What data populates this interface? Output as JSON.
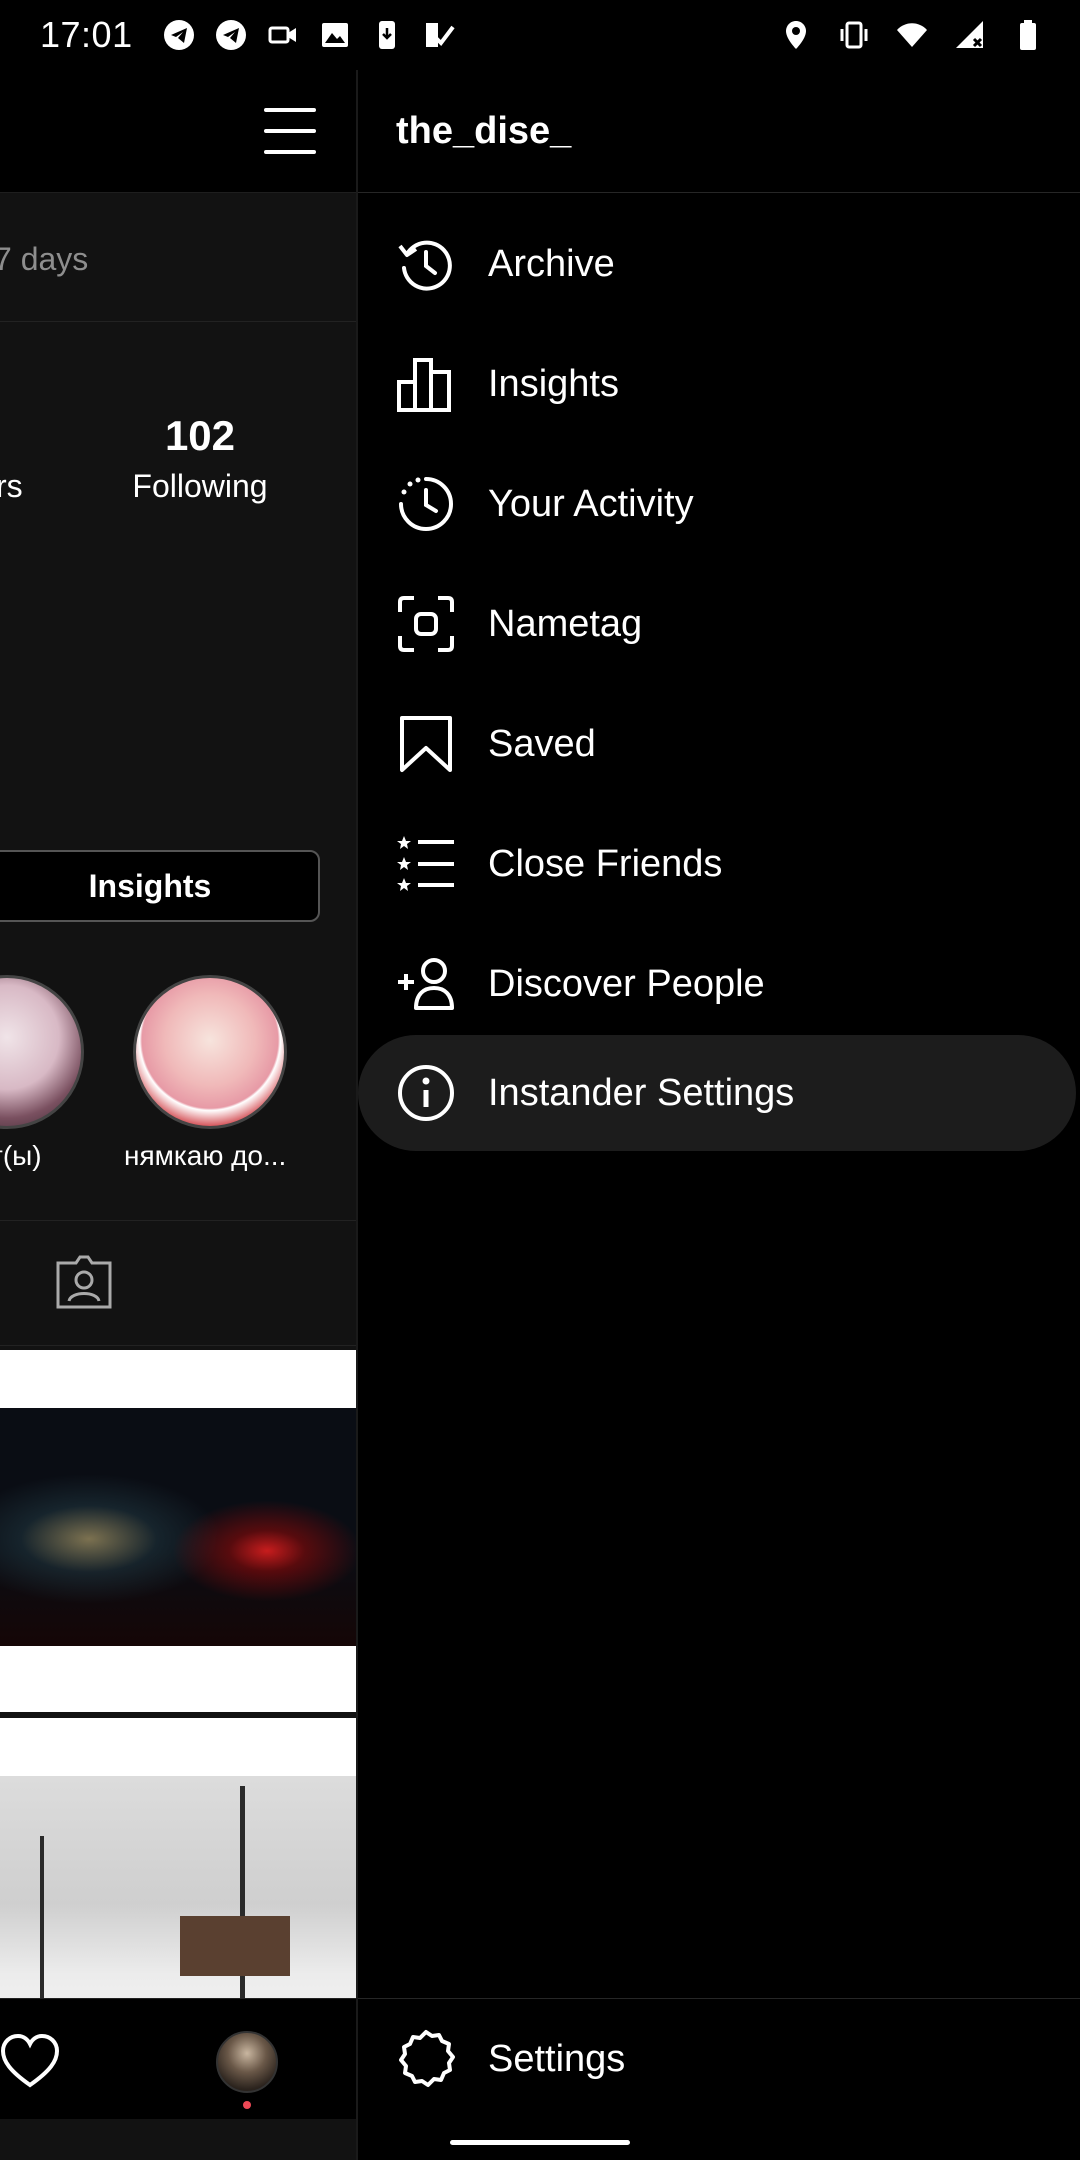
{
  "status_bar": {
    "time": "17:01"
  },
  "profile_pane": {
    "days_text": "7 days",
    "followers_label_cut": "rs",
    "following_count": "102",
    "following_label": "Following",
    "insights_button": "Insights",
    "highlights": [
      {
        "label": "т(ы)"
      },
      {
        "label": "нямкаю до..."
      }
    ]
  },
  "drawer": {
    "username": "the_dise_",
    "menu": [
      {
        "label": "Archive",
        "icon": "archive-icon"
      },
      {
        "label": "Insights",
        "icon": "insights-icon"
      },
      {
        "label": "Your Activity",
        "icon": "activity-icon"
      },
      {
        "label": "Nametag",
        "icon": "nametag-icon"
      },
      {
        "label": "Saved",
        "icon": "saved-icon"
      },
      {
        "label": "Close Friends",
        "icon": "close-friends-icon"
      },
      {
        "label": "Discover People",
        "icon": "discover-people-icon"
      },
      {
        "label": "Instander Settings",
        "icon": "info-icon",
        "active": true
      }
    ],
    "settings_label": "Settings"
  },
  "colors": {
    "background": "#000000",
    "active_item": "#1c1c1c",
    "notification_dot": "#ed4956"
  }
}
